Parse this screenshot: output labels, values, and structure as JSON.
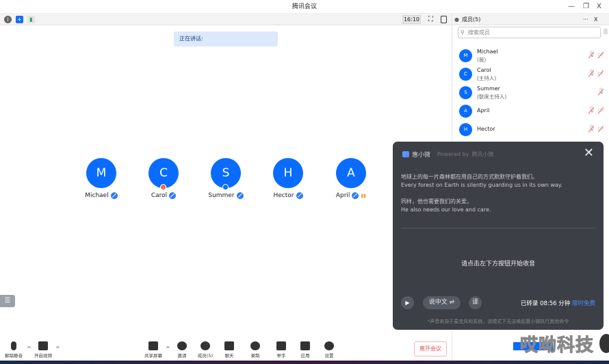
{
  "window": {
    "title": "腾讯会议",
    "minimize": "—",
    "restore": "❐",
    "close": "X"
  },
  "topbar": {
    "aspect_ratio": "16:10",
    "speaking_label": "正在讲话:"
  },
  "participants": [
    {
      "initial": "M",
      "name": "Michael"
    },
    {
      "initial": "C",
      "name": "Carol"
    },
    {
      "initial": "S",
      "name": "Summer"
    },
    {
      "initial": "H",
      "name": "Hector"
    },
    {
      "initial": "A",
      "name": "April"
    }
  ],
  "panel": {
    "title": "成员(5)",
    "more": "···",
    "close": "X",
    "search_placeholder": "搜索成员",
    "members": [
      {
        "initial": "M",
        "name": "Michael",
        "role": "(我)"
      },
      {
        "initial": "C",
        "name": "Carol",
        "role": "(主持人)"
      },
      {
        "initial": "S",
        "name": "Summer",
        "role": "(联席主持人)"
      },
      {
        "initial": "A",
        "name": "April",
        "role": ""
      },
      {
        "initial": "H",
        "name": "Hector",
        "role": ""
      }
    ]
  },
  "assistant": {
    "name": "惠小微",
    "powered": "Powered by",
    "brand": "腾讯小微",
    "lines": [
      {
        "zh": "地球上的每一片森林都在用自己的方式默默守护着我们。",
        "en": "Every forest on Earth is silently guarding us in its own way."
      },
      {
        "zh": "同样，他也需要我们的关爱。",
        "en": "He also needs our love and care."
      }
    ],
    "hint": "请点击左下方按钮开始收音",
    "lang_button": "说中文 ⇌",
    "translate_button": "译",
    "status_prefix": "已转录",
    "duration": "08:56",
    "unit": "分钟",
    "free_label": "限时免费",
    "note": "*声音来源于麦克风和系统，该模式下无法唤起惠小微执行其他命令"
  },
  "toolbar": {
    "unmute": "解除静音",
    "start_video": "开启视频",
    "share": "共享屏幕",
    "invite": "邀请",
    "members": "成员(5)",
    "chat": "聊天",
    "record": "录制",
    "raise_hand": "举手",
    "apps": "应用",
    "settings": "设置",
    "leave": "离开会议"
  },
  "watermark": "哎呦科技"
}
